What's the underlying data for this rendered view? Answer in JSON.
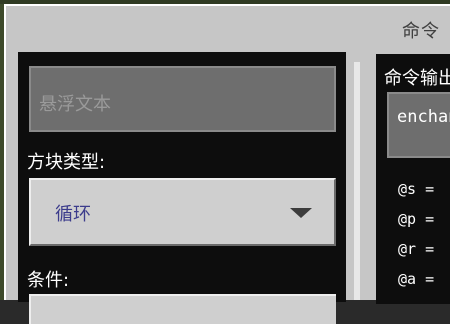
{
  "window": {
    "title": "命令"
  },
  "left": {
    "hover_placeholder": "悬浮文本",
    "block_type_label": "方块类型:",
    "block_type_value": "循环",
    "condition_label": "条件:"
  },
  "right": {
    "output_label": "命令输出",
    "command_value": "enchan",
    "selectors": [
      "@s = ",
      "@p = ",
      "@r = ",
      "@a = "
    ]
  }
}
